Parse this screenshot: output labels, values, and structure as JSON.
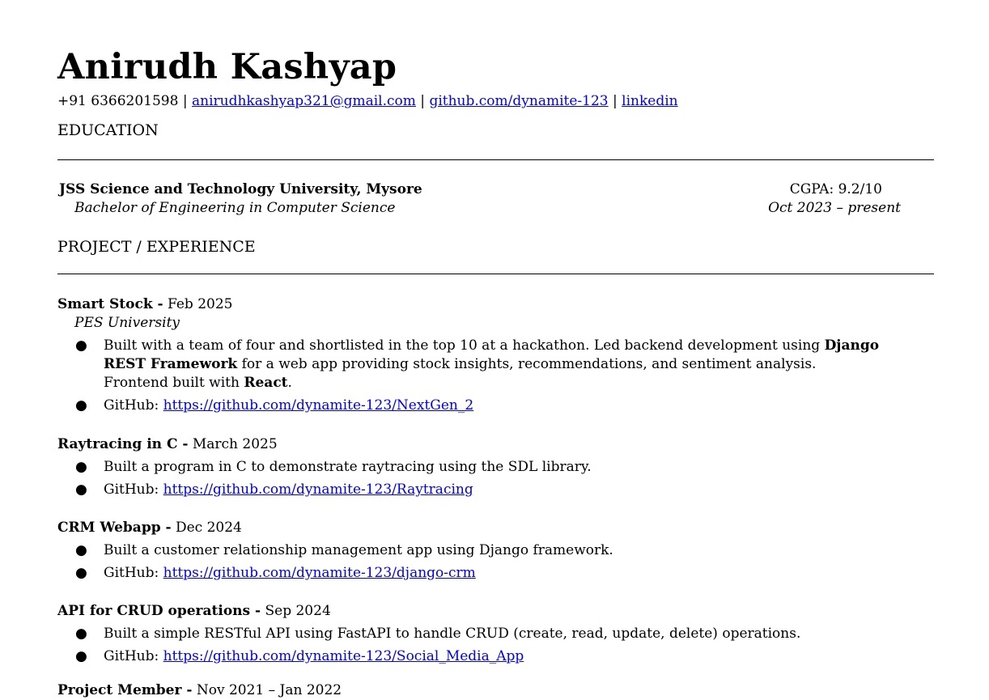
{
  "header": {
    "name": "Anirudh Kashyap",
    "phone": "+91 6366201598",
    "separator": " | ",
    "email": "anirudhkashyap321@gmail.com",
    "github": "github.com/dynamite-123",
    "linkedin": "linkedin"
  },
  "education": {
    "title": "EDUCATION",
    "school": "JSS Science and Technology University,  Mysore",
    "degree": "Bachelor of Engineering in Computer Science",
    "cgpa": "CGPA: 9.2/10",
    "dates": "Oct 2023  –  present"
  },
  "experience": {
    "title": "PROJECT / EXPERIENCE",
    "projects": [
      {
        "name": "Smart Stock -",
        "date": "Feb 2025",
        "org": "PES University",
        "desc_1": "Built with a team of four and shortlisted in the top 10 at a hackathon. Led backend development using ",
        "desc_b1": "Django REST Framework",
        "desc_2": " for a web app providing stock insights, recommendations, and sentiment analysis. Frontend built with ",
        "desc_b2": "React",
        "desc_3": ".",
        "github_label": "GitHub: ",
        "github_url": "https://github.com/dynamite-123/NextGen_2"
      },
      {
        "name": "Raytracing in C -",
        "date": "March  2025",
        "desc": "Built a program in C to demonstrate raytracing using the SDL library.",
        "github_label": "GitHub: ",
        "github_url": "https://github.com/dynamite-123/Raytracing"
      },
      {
        "name": "CRM Webapp -",
        "date": "Dec  2024",
        "desc": "Built a customer relationship management app using Django framework.",
        "github_label": "GitHub: ",
        "github_url": "https://github.com/dynamite-123/django-crm"
      },
      {
        "name": "API for CRUD operations -",
        "date": "Sep  2024",
        "desc": "Built a simple RESTful API using FastAPI to handle CRUD (create, read, update, delete) operations.",
        "github_label": "GitHub: ",
        "github_url": "https://github.com/dynamite-123/Social_Media_App"
      },
      {
        "name": "Project Member -",
        "date": "Nov  2021  –  Jan  2022"
      }
    ]
  },
  "bullet_glyph": "●"
}
